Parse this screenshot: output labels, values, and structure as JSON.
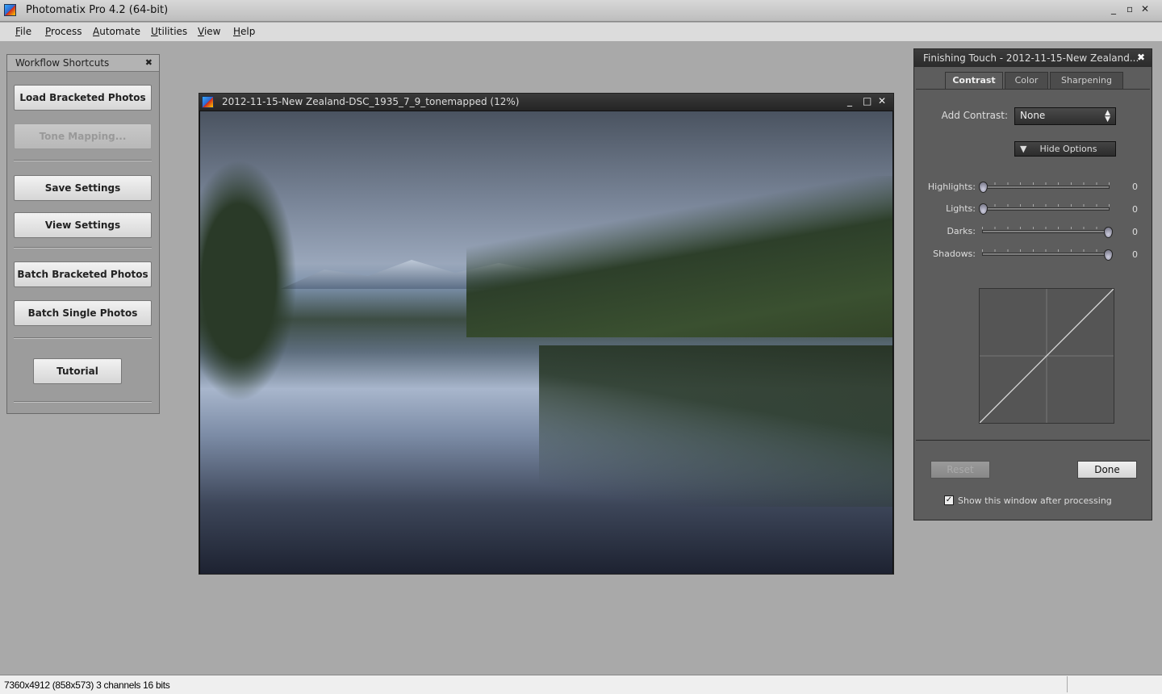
{
  "app": {
    "title": "Photomatix Pro 4.2 (64-bit)",
    "window_controls": [
      "_",
      "▫",
      "✕"
    ]
  },
  "menu": [
    "File",
    "Process",
    "Automate",
    "Utilities",
    "View",
    "Help"
  ],
  "workflow": {
    "title": "Workflow Shortcuts",
    "close": "✖",
    "buttons": [
      {
        "label": "Load Bracketed Photos",
        "enabled": true
      },
      {
        "label": "Tone Mapping...",
        "enabled": false
      },
      {
        "label": "Save Settings",
        "enabled": true
      },
      {
        "label": "View Settings",
        "enabled": true
      },
      {
        "label": "Batch Bracketed Photos",
        "enabled": true
      },
      {
        "label": "Batch Single Photos",
        "enabled": true
      },
      {
        "label": "Tutorial",
        "enabled": true
      }
    ]
  },
  "image_window": {
    "title": "2012-11-15-New Zealand-DSC_1935_7_9_tonemapped (12%)",
    "controls": [
      "_",
      "□",
      "✕"
    ]
  },
  "finishing": {
    "title": "Finishing Touch  -  2012-11-15-New Zealand...",
    "close": "✖",
    "tabs": [
      {
        "label": "Contrast",
        "active": true
      },
      {
        "label": "Color",
        "active": false
      },
      {
        "label": "Sharpening",
        "active": false
      }
    ],
    "add_contrast_label": "Add Contrast:",
    "add_contrast_value": "None",
    "hide_options": "Hide Options",
    "sliders": [
      {
        "label": "Highlights:",
        "value": "0",
        "position": 0
      },
      {
        "label": "Lights:",
        "value": "0",
        "position": 0
      },
      {
        "label": "Darks:",
        "value": "0",
        "position": 1
      },
      {
        "label": "Shadows:",
        "value": "0",
        "position": 1
      }
    ],
    "reset": "Reset",
    "done": "Done",
    "show_after": "Show this window after processing",
    "show_after_checked": true
  },
  "status": {
    "text": "7360x4912 (858x573) 3 channels 16 bits"
  }
}
